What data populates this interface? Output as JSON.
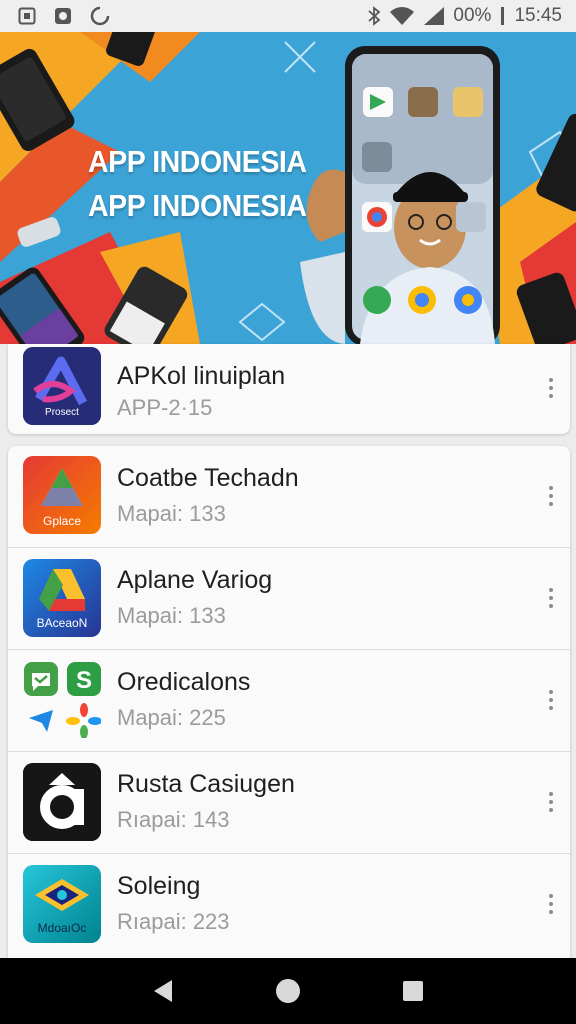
{
  "status_bar": {
    "battery": "00%",
    "time": "15:45",
    "icons": [
      "screenshot-icon",
      "media-icon",
      "sync-icon",
      "bluetooth-icon",
      "wifi-icon",
      "signal-icon"
    ]
  },
  "banner": {
    "title_line1": "APP INDONESIA",
    "title_line2": "APP INDONESIA",
    "accent_colors": [
      "#3aa0d2",
      "#f5a623",
      "#e53935"
    ]
  },
  "apps": [
    {
      "name": "APKol linuiplan",
      "subtitle": "APP-2·15",
      "icon": "stylized-a-icon",
      "icon_label": "Prosect"
    },
    {
      "name": "Coatbe Techadn",
      "subtitle": "Mapai: 133",
      "icon": "triangle-logo-icon",
      "icon_label": "Gplace"
    },
    {
      "name": "Aplane Variog",
      "subtitle": "Mapai: 133",
      "icon": "drive-logo-icon",
      "icon_label": "BAceaoN"
    },
    {
      "name": "Oredicalons",
      "subtitle": "Mapai: 225",
      "icon": "app-cluster-icon",
      "icon_label": ""
    },
    {
      "name": "Rusta Casiugen",
      "subtitle": "Rıapai: 143",
      "icon": "a-letter-icon",
      "icon_label": ""
    },
    {
      "name": "Soleing",
      "subtitle": "Rıapai: 223",
      "icon": "eye-logo-icon",
      "icon_label": "MdoaıOc"
    }
  ],
  "nav": {
    "buttons": [
      "back-icon",
      "home-icon",
      "recents-icon"
    ]
  }
}
